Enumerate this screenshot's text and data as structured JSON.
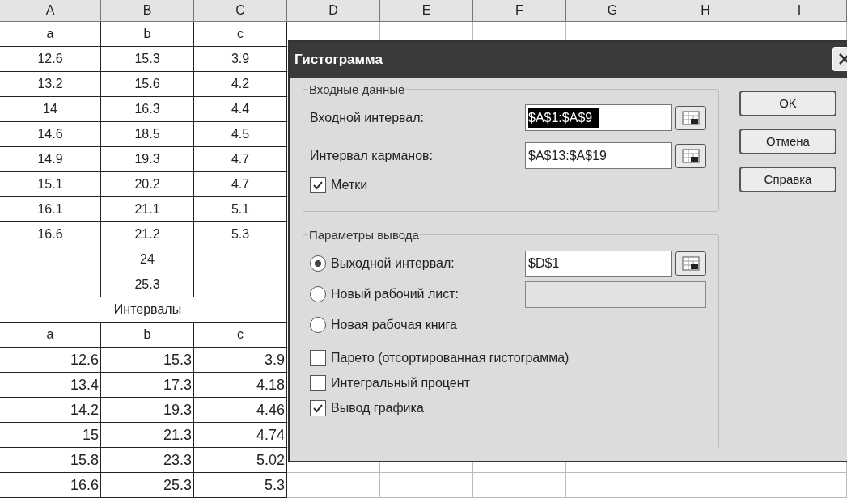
{
  "sheet": {
    "columns": [
      "A",
      "B",
      "C",
      "D",
      "E",
      "F",
      "G",
      "H",
      "I"
    ],
    "rows": [
      {
        "kind": "center",
        "cells": [
          "a",
          "b",
          "c"
        ]
      },
      {
        "kind": "center",
        "cells": [
          "12.6",
          "15.3",
          "3.9"
        ]
      },
      {
        "kind": "center",
        "cells": [
          "13.2",
          "15.6",
          "4.2"
        ]
      },
      {
        "kind": "center",
        "cells": [
          "14",
          "16.3",
          "4.4"
        ]
      },
      {
        "kind": "center",
        "cells": [
          "14.6",
          "18.5",
          "4.5"
        ]
      },
      {
        "kind": "center",
        "cells": [
          "14.9",
          "19.3",
          "4.7"
        ]
      },
      {
        "kind": "center",
        "cells": [
          "15.1",
          "20.2",
          "4.7"
        ]
      },
      {
        "kind": "center",
        "cells": [
          "16.1",
          "21.1",
          "5.1"
        ]
      },
      {
        "kind": "center",
        "cells": [
          "16.6",
          "21.2",
          "5.3"
        ]
      },
      {
        "kind": "center",
        "cells": [
          null,
          "24",
          null
        ]
      },
      {
        "kind": "center",
        "cells": [
          null,
          "25.3",
          null
        ]
      },
      {
        "kind": "merged",
        "cells": [
          null,
          "Интервалы",
          null
        ]
      },
      {
        "kind": "center",
        "cells": [
          "a",
          "b",
          "c"
        ]
      },
      {
        "kind": "right",
        "cells": [
          "12.6",
          "15.3",
          "3.9"
        ]
      },
      {
        "kind": "right",
        "cells": [
          "13.4",
          "17.3",
          "4.18"
        ]
      },
      {
        "kind": "right",
        "cells": [
          "14.2",
          "19.3",
          "4.46"
        ]
      },
      {
        "kind": "right",
        "cells": [
          "15",
          "21.3",
          "4.74"
        ]
      },
      {
        "kind": "right",
        "cells": [
          "15.8",
          "23.3",
          "5.02"
        ]
      },
      {
        "kind": "right",
        "cells": [
          "16.6",
          "25.3",
          "5.3"
        ]
      }
    ]
  },
  "dialog": {
    "title": "Гистограмма",
    "input_group": {
      "title": "Входные данные",
      "fields": [
        {
          "label": "Входной интервал:",
          "value": "$A$1:$A$9",
          "text_selected": true
        },
        {
          "label": "Интервал карманов:",
          "value": "$A$13:$A$19",
          "text_selected": false
        }
      ],
      "labels_checkbox": {
        "label": "Метки",
        "checked": true
      }
    },
    "output_group": {
      "title": "Параметры вывода",
      "options": [
        {
          "kind": "radio",
          "label": "Выходной интервал:",
          "selected": true,
          "field": {
            "value": "$D$1",
            "disabled": false
          }
        },
        {
          "kind": "radio",
          "label": "Новый рабочий лист:",
          "selected": false,
          "field": {
            "disabled": true
          }
        },
        {
          "kind": "radio",
          "label": "Новая рабочая книга",
          "selected": false
        },
        {
          "kind": "checkbox",
          "label": "Парето (отсортированная гистограмма)",
          "checked": false
        },
        {
          "kind": "checkbox",
          "label": "Интегральный процент",
          "checked": false
        },
        {
          "kind": "checkbox",
          "label": "Вывод графика",
          "checked": true
        }
      ]
    },
    "buttons": [
      "OK",
      "Отмена",
      "Справка"
    ]
  }
}
